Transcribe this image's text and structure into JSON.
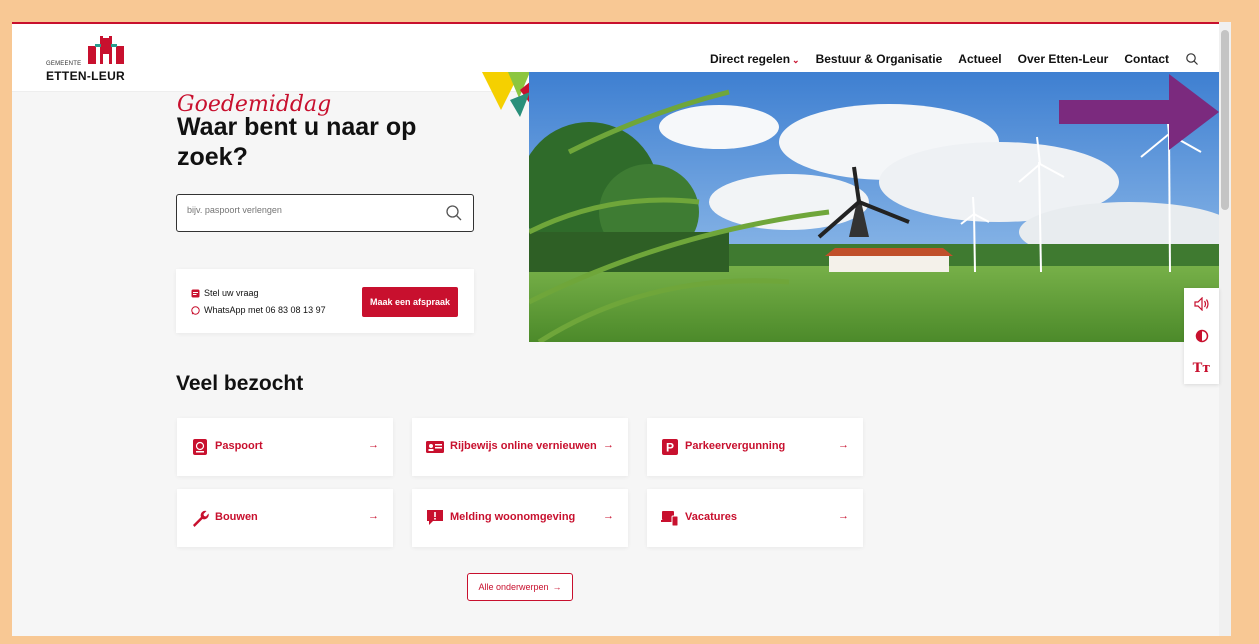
{
  "header": {
    "logo": {
      "small": "GEMEENTE",
      "big": "ETTEN-LEUR"
    },
    "nav": [
      {
        "label": "Direct regelen"
      },
      {
        "label": "Bestuur & Organisatie"
      },
      {
        "label": "Actueel"
      },
      {
        "label": "Over Etten-Leur"
      },
      {
        "label": "Contact"
      }
    ],
    "search_icon": "search-icon"
  },
  "hero": {
    "greeting": "Goedemiddag",
    "headline": "Waar bent u naar op zoek?",
    "search": {
      "placeholder": "bijv. paspoort verlengen",
      "value": ""
    },
    "contact": {
      "question_label": "Stel uw vraag",
      "whatsapp_label": "WhatsApp met 06 83 08 13 97",
      "appointment_button": "Maak een afspraak"
    }
  },
  "accessibility": {
    "items": [
      "speaker-icon",
      "contrast-icon",
      "text-size-icon"
    ],
    "text_size_glyph": "Tт"
  },
  "popular": {
    "title": "Veel bezocht",
    "cards": [
      {
        "label": "Paspoort",
        "icon": "passport-icon"
      },
      {
        "label": "Rijbewijs online vernieuwen",
        "icon": "id-card-icon"
      },
      {
        "label": "Parkeervergunning",
        "icon": "parking-icon"
      },
      {
        "label": "Bouwen",
        "icon": "wrench-icon"
      },
      {
        "label": "Melding woonomgeving",
        "icon": "alert-message-icon"
      },
      {
        "label": "Vacatures",
        "icon": "devices-icon"
      }
    ],
    "all_button": "Alle onderwerpen"
  },
  "colors": {
    "brand": "#c8102e",
    "annotation_arrow": "#7b2a7e",
    "frame": "#f8c894"
  }
}
